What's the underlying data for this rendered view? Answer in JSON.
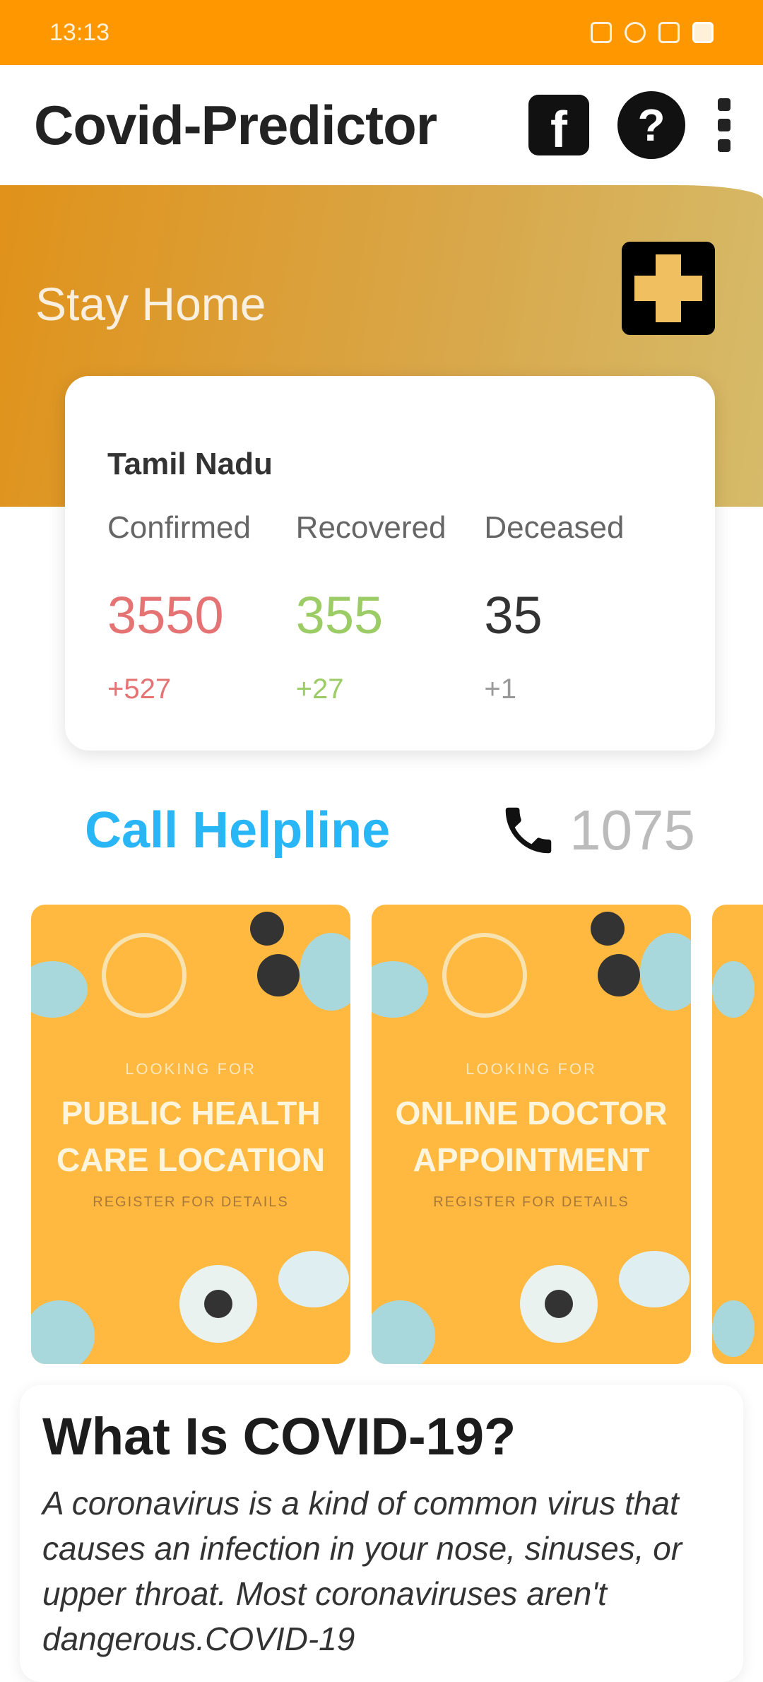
{
  "status_bar": {
    "time": "13:13"
  },
  "app_bar": {
    "title": "Covid-Predictor",
    "icons": [
      "facebook-icon",
      "help-icon",
      "more-vert-icon"
    ]
  },
  "hero": {
    "message": "Stay Home",
    "icon": "medical-cross-icon"
  },
  "stats": {
    "region": "Tamil Nadu",
    "columns": [
      {
        "label": "Confirmed",
        "value": "3550",
        "delta": "+527",
        "color": "#e57373"
      },
      {
        "label": "Recovered",
        "value": "355",
        "delta": "+27",
        "color": "#9ccc65"
      },
      {
        "label": "Deceased",
        "value": "35",
        "delta": "+1",
        "color": "#333333"
      }
    ]
  },
  "helpline": {
    "label": "Call Helpline",
    "number": "1075",
    "icon": "phone-icon"
  },
  "carousel": {
    "posters": [
      {
        "eyebrow": "LOOKING FOR",
        "title_line1": "PUBLIC HEALTH",
        "title_line2": "CARE LOCATION",
        "sub": "REGISTER FOR DETAILS"
      },
      {
        "eyebrow": "LOOKING FOR",
        "title_line1": "ONLINE DOCTOR",
        "title_line2": "APPOINTMENT",
        "sub": "REGISTER FOR DETAILS"
      }
    ]
  },
  "info": {
    "title": "What Is COVID-19?",
    "body": "A coronavirus is a kind of common virus that causes an infection in your nose, sinuses, or upper throat. Most coronaviruses aren't dangerous.COVID-19"
  },
  "colors": {
    "status_bar": "#ff9800",
    "accent": "#29b6f6",
    "confirmed": "#e57373",
    "recovered": "#9ccc65"
  }
}
